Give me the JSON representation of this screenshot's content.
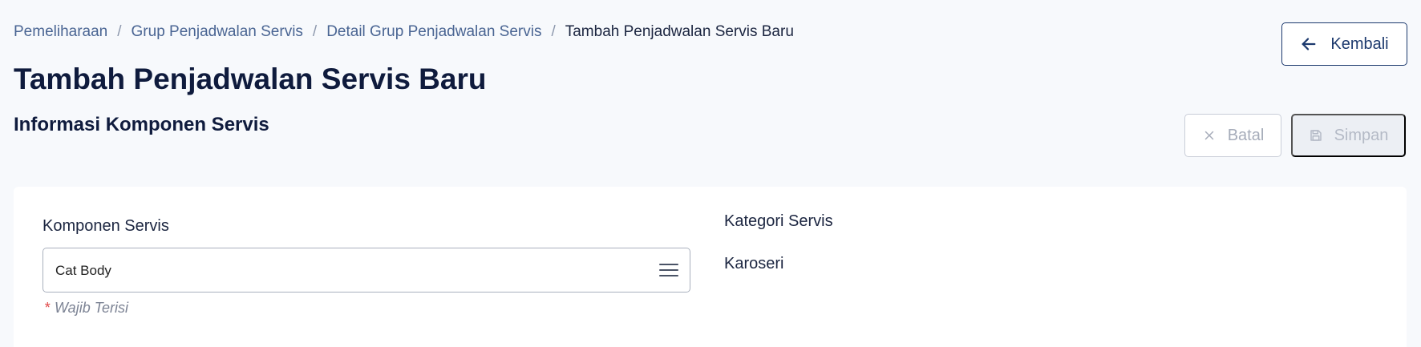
{
  "breadcrumb": {
    "items": [
      "Pemeliharaan",
      "Grup Penjadwalan Servis",
      "Detail Grup Penjadwalan Servis"
    ],
    "current": "Tambah Penjadwalan Servis Baru",
    "separator": "/"
  },
  "header": {
    "title": "Tambah Penjadwalan Servis Baru",
    "back_label": "Kembali"
  },
  "section": {
    "title": "Informasi Komponen Servis",
    "cancel_label": "Batal",
    "save_label": "Simpan"
  },
  "form": {
    "component_label": "Komponen Servis",
    "component_value": "Cat Body",
    "required_star": "*",
    "required_text": "Wajib Terisi",
    "category_label": "Kategori Servis",
    "category_value": "Karoseri"
  },
  "colors": {
    "primary": "#1d3a6e",
    "link": "#4a6593",
    "required": "#e04848",
    "background": "#f7f9fc"
  },
  "icons": {
    "back": "arrow-left-icon",
    "cancel": "close-icon",
    "save": "save-icon",
    "select": "menu-icon"
  }
}
